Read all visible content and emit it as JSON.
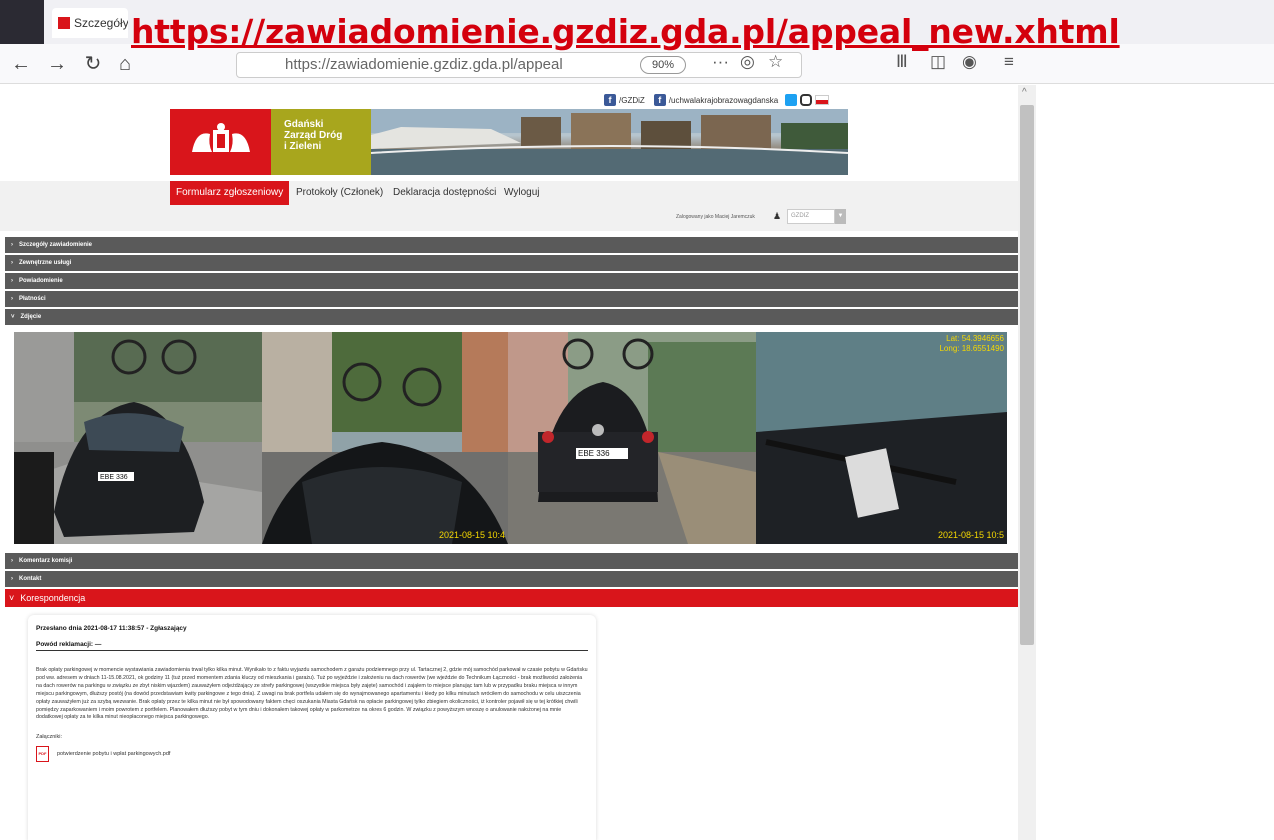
{
  "browser": {
    "tab_title": "Szczegóły",
    "url_overlay": "https://zawiadomienie.gzdiz.gda.pl/appeal_new.xhtml",
    "url_bar_text": "https://zawiadomienie.gzdiz.gda.pl/appeal",
    "zoom": "90%"
  },
  "social": {
    "fb1": "/GZDiZ",
    "fb2": "/uchwalakrajobrazowagdanska"
  },
  "header": {
    "org_line1": "Gdański",
    "org_line2": "Zarząd Dróg",
    "org_line3": "i Zieleni"
  },
  "nav": {
    "items": [
      {
        "label": "Formularz zgłoszeniowy"
      },
      {
        "label": "Protokoły (Członek)"
      },
      {
        "label": "Deklaracja dostępności"
      },
      {
        "label": "Wyloguj"
      }
    ],
    "logged_in": "Zalogowany jako Maciej Jaremczuk",
    "user_select": "GZDIZ"
  },
  "sections": [
    {
      "label": "Szczegóły zawiadomienie"
    },
    {
      "label": "Zewnętrzne usługi"
    },
    {
      "label": "Powiadomienie"
    },
    {
      "label": "Płatności"
    },
    {
      "label": "Zdjęcie"
    },
    {
      "label": "Komentarz komisji"
    },
    {
      "label": "Kontakt"
    },
    {
      "label": "Korespondencja"
    }
  ],
  "photos": {
    "plate": "EBE 336",
    "timestamp2": "2021-08-15 10:4",
    "timestamp4": "2021-08-15 10:5",
    "gps_lat": "Lat: 54.3946656",
    "gps_long": "Long: 18.6551490"
  },
  "message": {
    "header": "Przesłano dnia 2021-08-17 11:38:57 - Zgłaszający",
    "reason": "Powód reklamacji: —",
    "body": "Brak opłaty parkingowej w momencie wystawiania zawiadomienia trwał tylko kilka minut. Wynikało to z faktu wyjazdu samochodem z garażu podziemnego przy ul. Tartacznej 2, gdzie mój samochód parkował w czasie pobytu w Gdańsku pod ww. adresem w dniach 11-15.08.2021, ok godziny 11 (tuż przed momentem zdania kluczy od mieszkania i garażu). Tuż po wyjeździe i założeniu na dach rowerów (we wjeździe do Technikum Łączności - brak możliwości założenia na dach rowerów na parkingu w związku ze zbyt niskim wjazdem) zauważyłem odjeżdżający ze strefy parkingowej (wszystkie miejsca były zajęte) samochód i zająłem to miejsce planując tam lub w przypadku braku miejsca w innym miejscu parkingowym, dłuższy postój (na dowód przedstawiam kwity parkingowe z tego dnia). Z uwagi na brak portfela udałem się do wynajmowanego apartamentu i kiedy po kilku minutach wróciłem do samochodu w celu uiszczenia opłaty zauważyłem już za szybą wezwanie. Brak opłaty przez te kilka minut nie był spowodowany faktem chęci oszukania Miasta Gdańsk na opłacie parkingowej tylko zbiegiem okoliczności, iż kontroler pojawił się w tej krótkiej chwili pomiędzy zaparkowaniem i moim powrotem z portfelem. Planowałem dłuższy pobyt w tym dniu i dokonałem takowej opłaty w parkometrze na okres 6 godzin. W związku z powyższym wnoszę o anulowanie nałożonej na mnie dodatkowej opłaty za te kilka minut nieopłaconego miejsca parkingowego.",
    "attachments_label": "Załączniki:",
    "attachment_file": "potwierdzenie pobytu i wpłat parkingowych.pdf"
  }
}
